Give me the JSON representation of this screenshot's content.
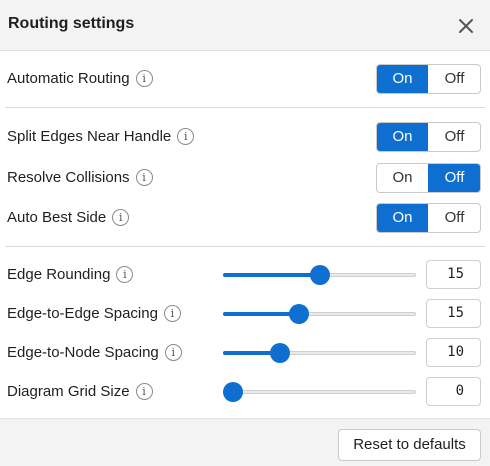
{
  "header": {
    "title": "Routing settings",
    "close_icon": "close-icon"
  },
  "automatic_routing": {
    "label": "Automatic Routing",
    "on_label": "On",
    "off_label": "Off",
    "selected": "On"
  },
  "split_edges": {
    "label": "Split Edges Near Handle",
    "on_label": "On",
    "off_label": "Off",
    "selected": "On"
  },
  "resolve_collisions": {
    "label": "Resolve Collisions",
    "on_label": "On",
    "off_label": "Off",
    "selected": "Off"
  },
  "auto_best_side": {
    "label": "Auto Best Side",
    "on_label": "On",
    "off_label": "Off",
    "selected": "On"
  },
  "sliders": [
    {
      "label": "Edge Rounding",
      "value": "15",
      "fraction": 0.5
    },
    {
      "label": "Edge-to-Edge Spacing",
      "value": "15",
      "fraction": 0.38
    },
    {
      "label": "Edge-to-Node Spacing",
      "value": "10",
      "fraction": 0.27
    },
    {
      "label": "Diagram Grid Size",
      "value": "0",
      "fraction": 0.0
    }
  ],
  "footer": {
    "reset_label": "Reset to defaults"
  },
  "colors": {
    "accent": "#0f6fd1",
    "header_bg": "#f3f3f3"
  },
  "info_icon": "info-icon"
}
